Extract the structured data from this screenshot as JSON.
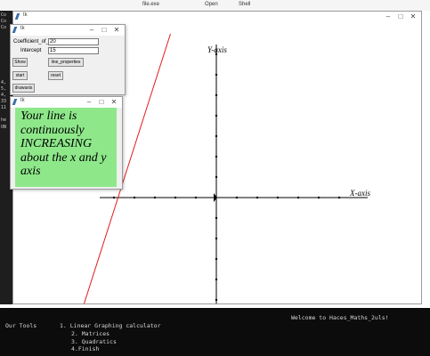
{
  "strip": {
    "items": [
      "file.exe",
      "Open",
      "Shell"
    ]
  },
  "left_console": {
    "lines": [
      "Co",
      "Co",
      "Co",
      "4,",
      "5,",
      "4,",
      "33",
      "11",
      "he",
      "ON"
    ]
  },
  "main_window": {
    "title": "tk",
    "x_axis_label": "X-axis",
    "y_axis_label": "Y-axis",
    "line": {
      "slope": 20,
      "intercept": 15,
      "color": "#e21c1c"
    },
    "axis_color": "#000000"
  },
  "control_window": {
    "title": "tk",
    "coefficient_label": "Coefficient_of_x",
    "coefficient_value": "20",
    "intercept_label": "Intercept",
    "intercept_value": "15",
    "buttons": {
      "show": "Show",
      "line_properties": "line_properties",
      "start": "start",
      "reset": "reset",
      "drawaxis": "drawaxis"
    }
  },
  "result_window": {
    "title": "tk",
    "message": "Your line is\ncontinuously\nINCREASING\n about the x and y\naxis",
    "background": "#8ee88a"
  },
  "console": {
    "welcome": "Welcome to Haces_Maths_2uls!",
    "tools_label": "Our Tools",
    "items": [
      "1. Linear Graphing calculator",
      "2. Matrices",
      "3. Quadratics",
      "4.Finish"
    ]
  }
}
